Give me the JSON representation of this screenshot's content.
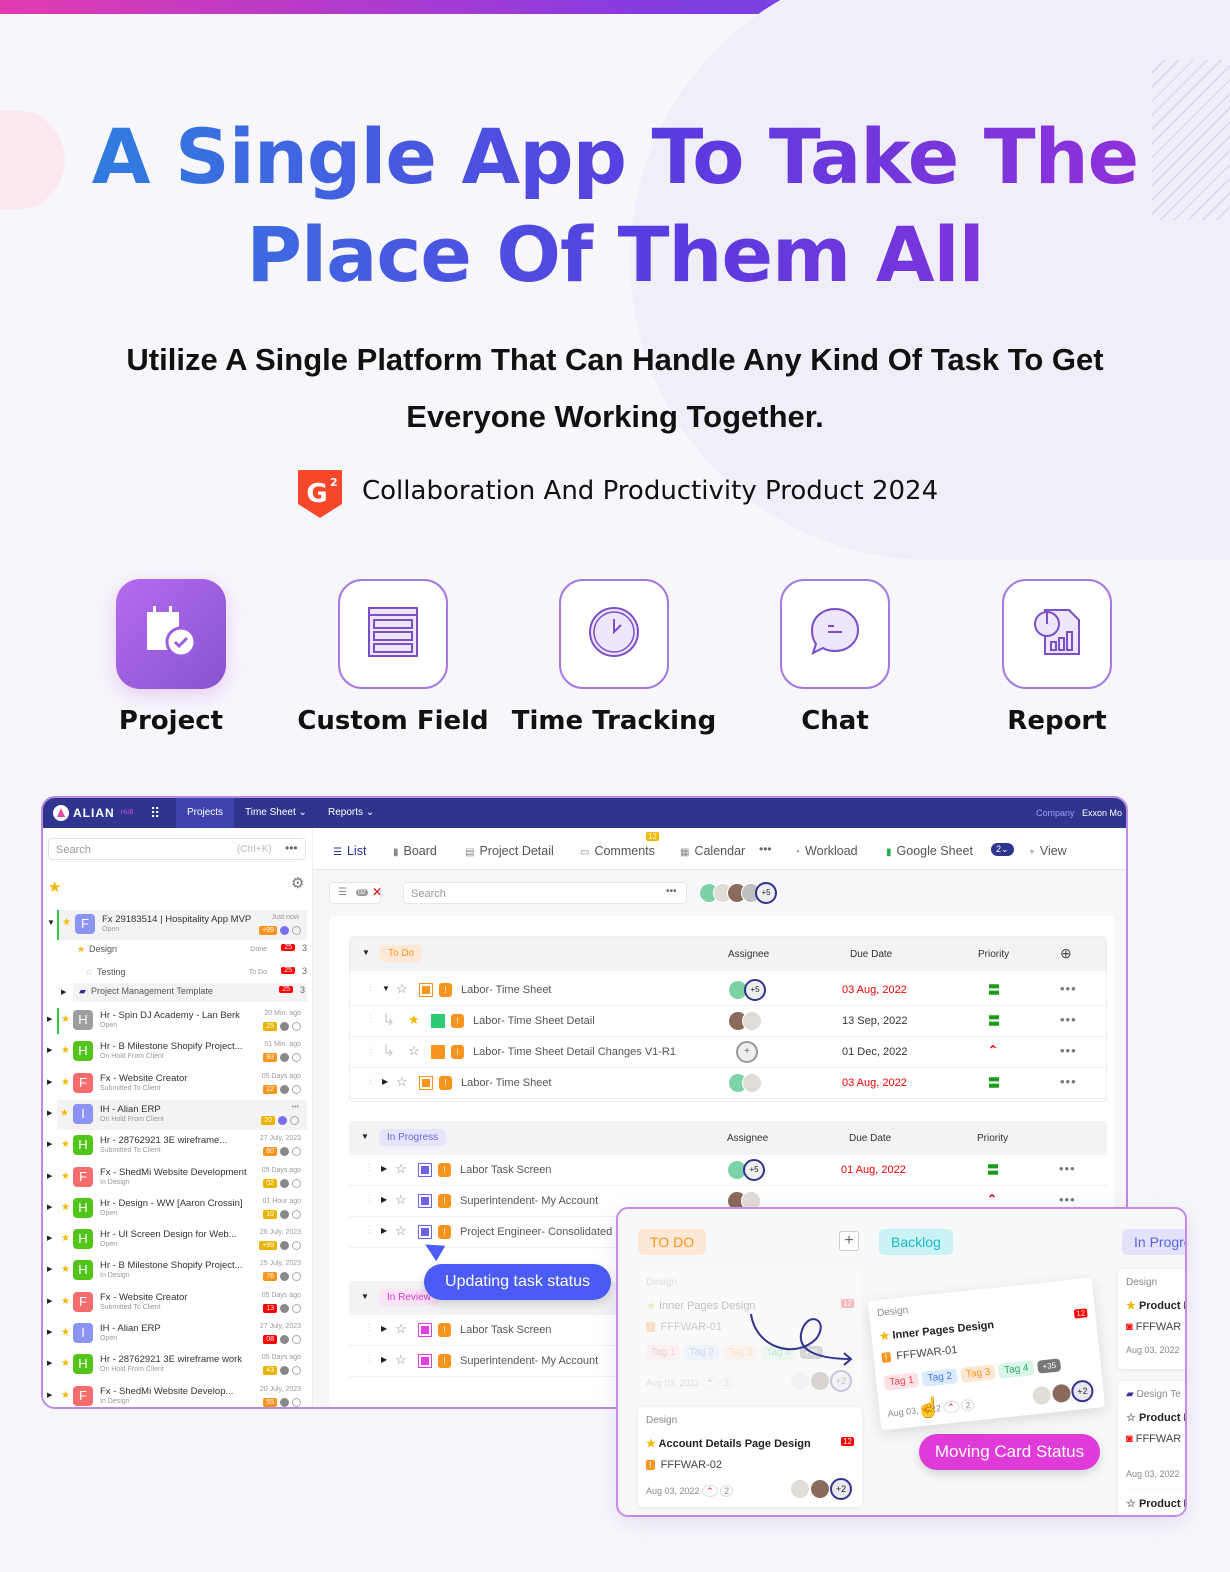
{
  "hero": {
    "headline_line1": "A Single App To Take The",
    "headline_line2": "Place Of Them All",
    "subtitle_line1": "Utilize A Single Platform That Can Handle Any Kind Of Task To Get",
    "subtitle_line2": "Everyone Working Together.",
    "award": "Collaboration And Productivity Product 2024",
    "award_logo": "G2"
  },
  "features": [
    {
      "label": "Project",
      "icon": "calendar-check-icon"
    },
    {
      "label": "Custom Field",
      "icon": "form-fields-icon"
    },
    {
      "label": "Time Tracking",
      "icon": "clock-icon"
    },
    {
      "label": "Chat",
      "icon": "chat-bubble-icon"
    },
    {
      "label": "Report",
      "icon": "report-chart-icon"
    }
  ],
  "app": {
    "logo": "ALIAN",
    "logo_suffix": "HUB",
    "nav": [
      "Projects",
      "Time Sheet",
      "Reports"
    ],
    "company_label": "Company",
    "company_name": "Exxon Mo",
    "colors": {
      "header": "#2f358f",
      "accent": "#3d44b0"
    },
    "sidebar": {
      "search_placeholder": "Search",
      "search_shortcut": "(Ctrl+K)",
      "expanded": {
        "initial": "F",
        "name": "Fx 29183514 | Hospitality App MVP",
        "status": "Open",
        "time": "Just now",
        "count": "+99",
        "children": [
          {
            "name": "Design",
            "state": "Done",
            "count": "25",
            "num": "3"
          },
          {
            "name": "Testing",
            "state": "To Do",
            "count": "25",
            "num": "3"
          },
          {
            "name": "Project Management Template",
            "count": "25",
            "num": "3"
          }
        ]
      },
      "projects": [
        {
          "initial": "H",
          "color": "#9e9e9e",
          "name": "Hr - Spin DJ Academy - Lan Berk",
          "status": "Open",
          "time": "20 Min. ago",
          "count": "25",
          "badge": "#e8b400"
        },
        {
          "initial": "H",
          "color": "#52c41a",
          "name": "Hr - B Milestone Shopify Project...",
          "status": "On Hold From Client",
          "time": "01 Min. ago",
          "count": "93",
          "badge": "#f7941d"
        },
        {
          "initial": "F",
          "color": "#f56c6c",
          "name": "Fx - Website Creator",
          "status": "Submitted To Client",
          "time": "05 Days ago",
          "count": "22",
          "badge": "#f7941d"
        },
        {
          "initial": "I",
          "color": "#8b93f5",
          "name": "IH - Alian ERP",
          "status": "On Hold From Client",
          "time": "•••",
          "count": "20",
          "badge": "#e8b400"
        },
        {
          "initial": "H",
          "color": "#52c41a",
          "name": "Hr - 28762921 3E wireframe...",
          "status": "Submitted To Client",
          "time": "27 July, 2023",
          "count": "80",
          "badge": "#f7941d"
        },
        {
          "initial": "F",
          "color": "#f56c6c",
          "name": "Fx - ShedMi Website Development",
          "status": "In Design",
          "time": "05 Days ago",
          "count": "02",
          "badge": "#e8b400"
        },
        {
          "initial": "H",
          "color": "#52c41a",
          "name": "Hr - Design - WW [Aaron Crossin]",
          "status": "Open",
          "time": "01 Hour ago",
          "count": "10",
          "badge": "#e8b400"
        },
        {
          "initial": "H",
          "color": "#52c41a",
          "name": "Hr - UI Screen Design for Web...",
          "status": "Open",
          "time": "26 July, 2023",
          "count": "+99",
          "badge": "#e8b400"
        },
        {
          "initial": "H",
          "color": "#52c41a",
          "name": "Hr - B Milestone Shopify Project...",
          "status": "In Design",
          "time": "25 July, 2023",
          "count": "76",
          "badge": "#f7941d"
        },
        {
          "initial": "F",
          "color": "#f56c6c",
          "name": "Fx - Website Creator",
          "status": "Submitted To Client",
          "time": "05 Days ago",
          "count": "13",
          "badge": "#f00"
        },
        {
          "initial": "I",
          "color": "#8b93f5",
          "name": "IH - Alian ERP",
          "status": "Open",
          "time": "27 July, 2023",
          "count": "08",
          "badge": "#f00"
        },
        {
          "initial": "H",
          "color": "#52c41a",
          "name": "Hr - 28762921 3E wireframe work",
          "status": "On Hold From Client",
          "time": "05 Days ago",
          "count": "43",
          "badge": "#e8b400"
        },
        {
          "initial": "F",
          "color": "#f56c6c",
          "name": "Fx - ShedMi Website Develop...",
          "status": "In Design",
          "time": "20 July, 2023",
          "count": "55",
          "badge": "#f7941d"
        }
      ]
    },
    "tabs": [
      {
        "label": "List",
        "active": true
      },
      {
        "label": "Board"
      },
      {
        "label": "Project Detail"
      },
      {
        "label": "Comments",
        "badge": "12"
      },
      {
        "label": "Calendar"
      },
      {
        "label": "Workload"
      },
      {
        "label": "Google Sheet"
      },
      {
        "label": "View"
      }
    ],
    "google_sheet_count": "2",
    "filter": {
      "count": "02",
      "search_placeholder": "Search",
      "more_members": "+5"
    },
    "columns": {
      "assignee": "Assignee",
      "due": "Due Date",
      "priority": "Priority"
    },
    "groups": [
      {
        "name": "To Do",
        "bg": "#fde8d6",
        "fg": "#f7941d",
        "tasks": [
          {
            "name": "Labor- Time Sheet",
            "sq": "#f7941d",
            "level": 0,
            "expanded": true,
            "assignees": [
              "#7dd3a7"
            ],
            "more": "+5",
            "due": "03 Aug, 2022",
            "overdue": true,
            "priority": "medium"
          },
          {
            "name": "Labor- Time Sheet Detail",
            "sq": "#2ecc71",
            "level": 1,
            "starred": true,
            "assignees": [
              "#8a6a5a",
              "#e0dcd6"
            ],
            "due": "13 Sep, 2022",
            "priority": "medium"
          },
          {
            "name": "Labor- Time Sheet Detail Changes V1-R1",
            "sq": "#f7941d",
            "level": 1,
            "assignees": [],
            "unassigned": true,
            "due": "01 Dec, 2022",
            "priority": "high"
          },
          {
            "name": "Labor- Time Sheet",
            "sq": "#f7941d",
            "level": 0,
            "assignees": [
              "#7dd3a7",
              "#e0dcd6"
            ],
            "due": "03 Aug, 2022",
            "overdue": true,
            "priority": "medium"
          }
        ]
      },
      {
        "name": "In Progress",
        "bg": "#e6e4fb",
        "fg": "#6a66e0",
        "tasks": [
          {
            "name": "Labor Task Screen",
            "sq": "#6b63e8",
            "level": 0,
            "assignees": [
              "#7dd3a7"
            ],
            "more": "+5",
            "due": "01 Aug, 2022",
            "overdue": true,
            "priority": "medium"
          },
          {
            "name": "Superintendent- My Account",
            "sq": "#6b63e8",
            "level": 0,
            "assignees": [
              "#8a6a5a",
              "#e0dcd6"
            ],
            "due": "",
            "priority": "high"
          },
          {
            "name": "Project Engineer- Consolidated",
            "sq": "#6b63e8",
            "level": 0,
            "assignees": [],
            "due": "",
            "priority": ""
          }
        ]
      },
      {
        "name": "In Review",
        "bg": "#fbe3f6",
        "fg": "#d63bd0",
        "tasks": [
          {
            "name": "Labor Task Screen",
            "sq": "#e040e0",
            "level": 0,
            "assignees": [],
            "due": "",
            "priority": ""
          },
          {
            "name": "Superintendent- My Account",
            "sq": "#e040e0",
            "level": 0,
            "assignees": [],
            "due": "",
            "priority": ""
          }
        ]
      }
    ],
    "callout_update": "Updating task status"
  },
  "board": {
    "columns": [
      "TO DO",
      "Backlog",
      "In Progre"
    ],
    "ghost_card": {
      "category": "Design",
      "title": "Inner Pages Design",
      "badge": "12",
      "code": "FFFWAR-01",
      "tags": [
        "Tag 1",
        "Tag 2",
        "Tag 3",
        "Tag 4"
      ],
      "more_tags": "+35",
      "date": "Aug 03, 2022",
      "subtasks": "2",
      "more": "+2"
    },
    "moving_card": {
      "category": "Design",
      "title": "Inner Pages Design",
      "badge": "12",
      "code": "FFFWAR-01",
      "tags": [
        "Tag 1",
        "Tag 2",
        "Tag 3",
        "Tag 4"
      ],
      "more_tags": "+35",
      "date": "Aug 03, 2022",
      "subtasks": "2",
      "more": "+2"
    },
    "card2": {
      "category": "Design",
      "title": "Account Details Page Design",
      "badge": "12",
      "code": "FFFWAR-02",
      "date": "Aug 03, 2022",
      "subtasks": "2",
      "more": "+2"
    },
    "right_cards": [
      {
        "category": "Design",
        "title": "Product I",
        "code": "FFFWAR",
        "date": "Aug 03, 2022"
      },
      {
        "category": "Design Te",
        "title": "Product I",
        "code": "FFFWAR",
        "date": "Aug 03, 2022"
      },
      {
        "title": "Product I"
      }
    ],
    "callout_move": "Moving Card Status"
  }
}
